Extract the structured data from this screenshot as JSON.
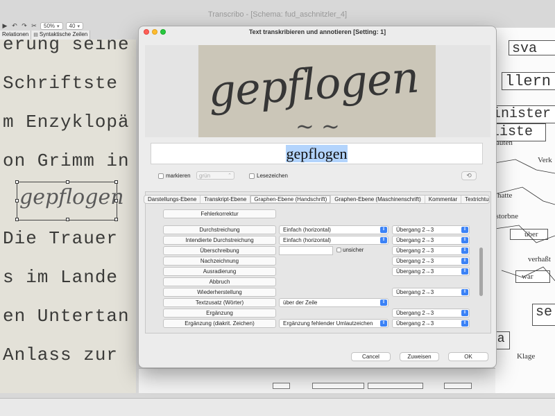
{
  "app": {
    "title": "Transcribo - [Schema: fud_aschnitzler_4]",
    "toolbar": {
      "play": "▶",
      "undo": "↶",
      "redo": "↷",
      "cut": "✂",
      "zoom_value": "50%",
      "size_value": "40"
    },
    "tabs": [
      {
        "label": "Relationen"
      },
      {
        "label": "Syntaktische Zeilen"
      }
    ]
  },
  "scan_left": {
    "lines": [
      "erung seine",
      "Schriftste",
      "m Enzyklopä",
      "on Grimm in",
      "Die Trauer",
      "s im Lande",
      "en Untertan",
      "Anlass zur"
    ],
    "handwriting": "gepflogen"
  },
  "scan_right": {
    "words": [
      "sva",
      "llern",
      "inister",
      "liste",
      "auten",
      "Verk",
      "hatte",
      "rstorbne",
      "über",
      "verhaßt",
      "war",
      "se",
      "ra",
      "Klage"
    ]
  },
  "dialog": {
    "title": "Text transkribieren und annotieren [Setting: 1]",
    "preview_handwriting": "gepflogen",
    "transcript": "gepflogen",
    "options": {
      "markieren": "markieren",
      "color": "grün",
      "lesezeichen": "Lesezeichen"
    },
    "tabs": [
      "Darstellungs-Ebene",
      "Transkript-Ebene",
      "Graphen-Ebene (Handschrift)",
      "Graphen-Ebene (Maschinenschrift)",
      "Kommentar",
      "Textrichtung"
    ],
    "active_tab": "Graphen-Ebene (Handschrift)",
    "rows": [
      {
        "label": "Fehlerkorrektur",
        "type": "button"
      },
      {
        "label": "Durchstreichung",
        "select1": "Einfach (horizontal)",
        "select2": "Übergang 2→3"
      },
      {
        "label": "Intendierte Durchstreichung",
        "select1": "Einfach (horizontal)",
        "select2": "Übergang 2→3"
      },
      {
        "label": "Überschreibung",
        "input": "",
        "checkbox": "unsicher",
        "select2": "Übergang 2→3"
      },
      {
        "label": "Nachzeichnung",
        "select2": "Übergang 2→3"
      },
      {
        "label": "Ausradierung",
        "select2": "Übergang 2→3"
      },
      {
        "label": "Abbruch"
      },
      {
        "label": "Wiederherstellung",
        "select2": "Übergang 2→3"
      },
      {
        "label": "Textzusatz (Wörter)",
        "select1": "über der Zeile"
      },
      {
        "label": "Ergänzung",
        "select2": "Übergang 2→3"
      },
      {
        "label": "Ergänzung (diakrit. Zeichen)",
        "select1": "Ergänzung fehlender Umlautzeichen",
        "select2": "Übergang 2→3"
      }
    ],
    "buttons": {
      "cancel": "Cancel",
      "assign": "Zuweisen",
      "ok": "OK"
    }
  },
  "colors": {
    "accent": "#3b82f6",
    "selection": "#b3d4fc",
    "close": "#fe5f57",
    "minimize": "#febc2e",
    "zoom": "#28c840"
  },
  "icons": {
    "history": "history-icon",
    "chevron": "chevron-updown-icon"
  }
}
